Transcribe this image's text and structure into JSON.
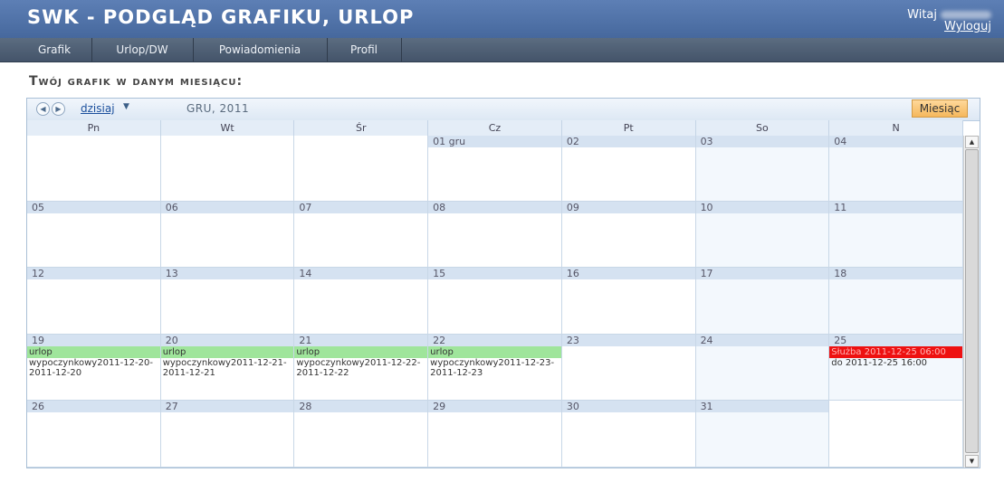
{
  "header": {
    "title": "SWK - PODGLĄD GRAFIKU, URLOP",
    "greeting": "Witaj",
    "logout": "Wyloguj"
  },
  "menu": [
    {
      "label": "Grafik"
    },
    {
      "label": "Urlop/DW"
    },
    {
      "label": "Powiadomienia"
    },
    {
      "label": "Profil"
    }
  ],
  "section_title": "Twój grafik w danym miesiącu:",
  "scheduler": {
    "today": "dzisiaj",
    "current_date": "GRU, 2011",
    "view_button": "Miesiąc",
    "day_names": [
      "Pn",
      "Wt",
      "Śr",
      "Cz",
      "Pt",
      "So",
      "N"
    ],
    "weeks": [
      [
        "",
        "",
        "",
        "01 gru",
        "02",
        "03",
        "04"
      ],
      [
        "05",
        "06",
        "07",
        "08",
        "09",
        "10",
        "11"
      ],
      [
        "12",
        "13",
        "14",
        "15",
        "16",
        "17",
        "18"
      ],
      [
        "19",
        "20",
        "21",
        "22",
        "23",
        "24",
        "25"
      ],
      [
        "26",
        "27",
        "28",
        "29",
        "30",
        "31",
        ""
      ]
    ],
    "appointments": [
      {
        "week": 3,
        "day": 0,
        "title": "urlop",
        "rest": "wypoczynkowy2011-12-20-2011-12-20"
      },
      {
        "week": 3,
        "day": 1,
        "title": "urlop",
        "rest": "wypoczynkowy2011-12-21-2011-12-21"
      },
      {
        "week": 3,
        "day": 2,
        "title": "urlop",
        "rest": "wypoczynkowy2011-12-22-2011-12-22"
      },
      {
        "week": 3,
        "day": 3,
        "title": "urlop",
        "rest": "wypoczynkowy2011-12-23-2011-12-23"
      },
      {
        "week": 3,
        "day": 6,
        "title": "Służba 2011-12-25 06:00",
        "rest": "do 2011-12-25 16:00",
        "red": true
      }
    ]
  }
}
